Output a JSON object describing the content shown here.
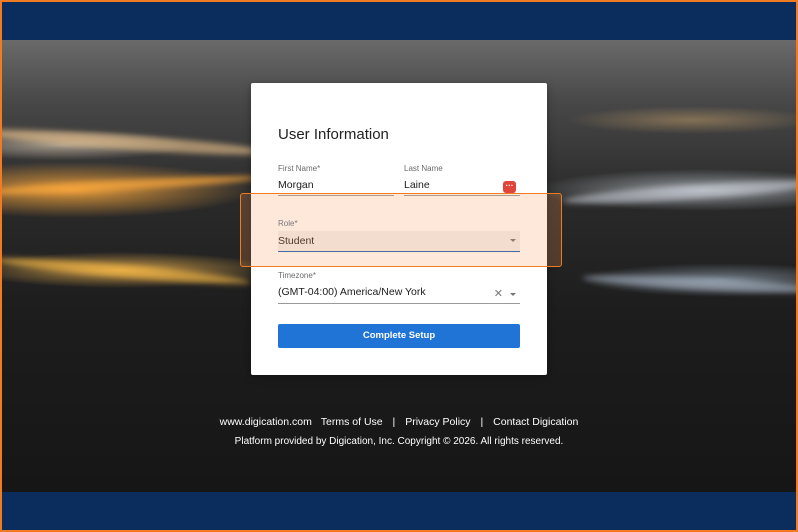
{
  "form": {
    "title": "User Information",
    "first_name": {
      "label": "First Name*",
      "value": "Morgan"
    },
    "last_name": {
      "label": "Last Name",
      "value": "Laine"
    },
    "role": {
      "label": "Role*",
      "value": "Student"
    },
    "timezone": {
      "label": "Timezone*",
      "value": "(GMT-04:00) America/New York"
    },
    "submit_label": "Complete Setup"
  },
  "footer": {
    "links": [
      "www.digication.com",
      "Terms of Use",
      "Privacy Policy",
      "Contact Digication"
    ],
    "separators": [
      "|",
      "|"
    ],
    "copyright": "Platform provided by Digication, Inc. Copyright © 2026. All rights reserved."
  },
  "icons": {
    "password_manager": "password-manager-icon",
    "clear": "close-icon",
    "dropdown": "chevron-down-icon"
  },
  "colors": {
    "header_bar": "#0b2d5e",
    "frame_accent": "#f07b22",
    "primary_button": "#1f74d6",
    "password_icon": "#e0443a"
  }
}
